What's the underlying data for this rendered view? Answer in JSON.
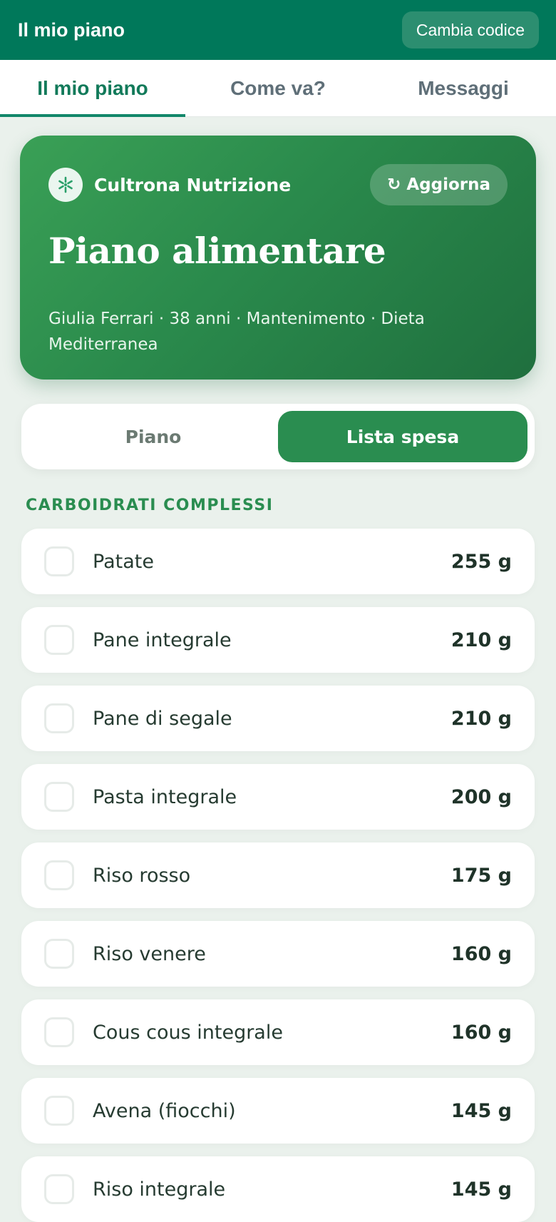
{
  "app_bar": {
    "title": "Il mio piano",
    "change_code_label": "Cambia codice"
  },
  "tabs": [
    {
      "label": "Il mio piano",
      "active": true
    },
    {
      "label": "Come va?",
      "active": false
    },
    {
      "label": "Messaggi",
      "active": false
    }
  ],
  "hero": {
    "brand_icon": "sparkle-icon",
    "brand_name": "Cultrona Nutrizione",
    "refresh_icon": "refresh-icon",
    "refresh_label": "Aggiorna",
    "title": "Piano alimentare",
    "subtitle": "Giulia Ferrari · 38 anni · Mantenimento · Dieta Mediterranea"
  },
  "segment": {
    "options": [
      {
        "label": "Piano",
        "active": false
      },
      {
        "label": "Lista spesa",
        "active": true
      }
    ]
  },
  "section": {
    "title": "CARBOIDRATI COMPLESSI",
    "items": [
      {
        "name": "Patate",
        "qty": "255 g"
      },
      {
        "name": "Pane integrale",
        "qty": "210 g"
      },
      {
        "name": "Pane di segale",
        "qty": "210 g"
      },
      {
        "name": "Pasta integrale",
        "qty": "200 g"
      },
      {
        "name": "Riso rosso",
        "qty": "175 g"
      },
      {
        "name": "Riso venere",
        "qty": "160 g"
      },
      {
        "name": "Cous cous integrale",
        "qty": "160 g"
      },
      {
        "name": "Avena (fiocchi)",
        "qty": "145 g"
      },
      {
        "name": "Riso integrale",
        "qty": "145 g"
      }
    ]
  },
  "colors": {
    "app_bar": "#00785a",
    "accent": "#2a8d50",
    "background": "#eaf1ec"
  }
}
